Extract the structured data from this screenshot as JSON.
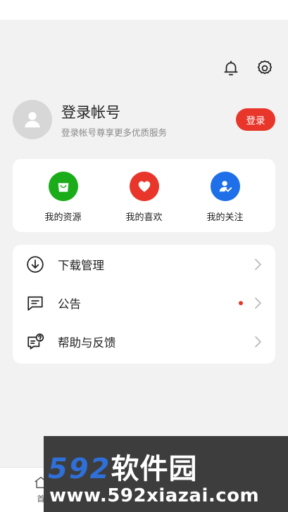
{
  "profile": {
    "title": "登录帐号",
    "subtitle": "登录帐号尊享更多优质服务",
    "login_label": "登录"
  },
  "shortcuts": [
    {
      "label": "我的资源",
      "icon": "shopping-bag-icon",
      "color": "#1aad19"
    },
    {
      "label": "我的喜欢",
      "icon": "heart-icon",
      "color": "#e8362b"
    },
    {
      "label": "我的关注",
      "icon": "user-check-icon",
      "color": "#1e6fe8"
    }
  ],
  "menu": [
    {
      "label": "下载管理",
      "icon": "download-icon",
      "badge": false
    },
    {
      "label": "公告",
      "icon": "announcement-icon",
      "badge": true
    },
    {
      "label": "帮助与反馈",
      "icon": "help-feedback-icon",
      "badge": false
    }
  ],
  "bottom_nav": {
    "home_label": "首"
  },
  "watermark": {
    "number": "592",
    "brand": "软件园",
    "url": "www.592xiazai.com"
  },
  "colors": {
    "accent_red": "#e8362b",
    "background": "#f2f2f2"
  }
}
